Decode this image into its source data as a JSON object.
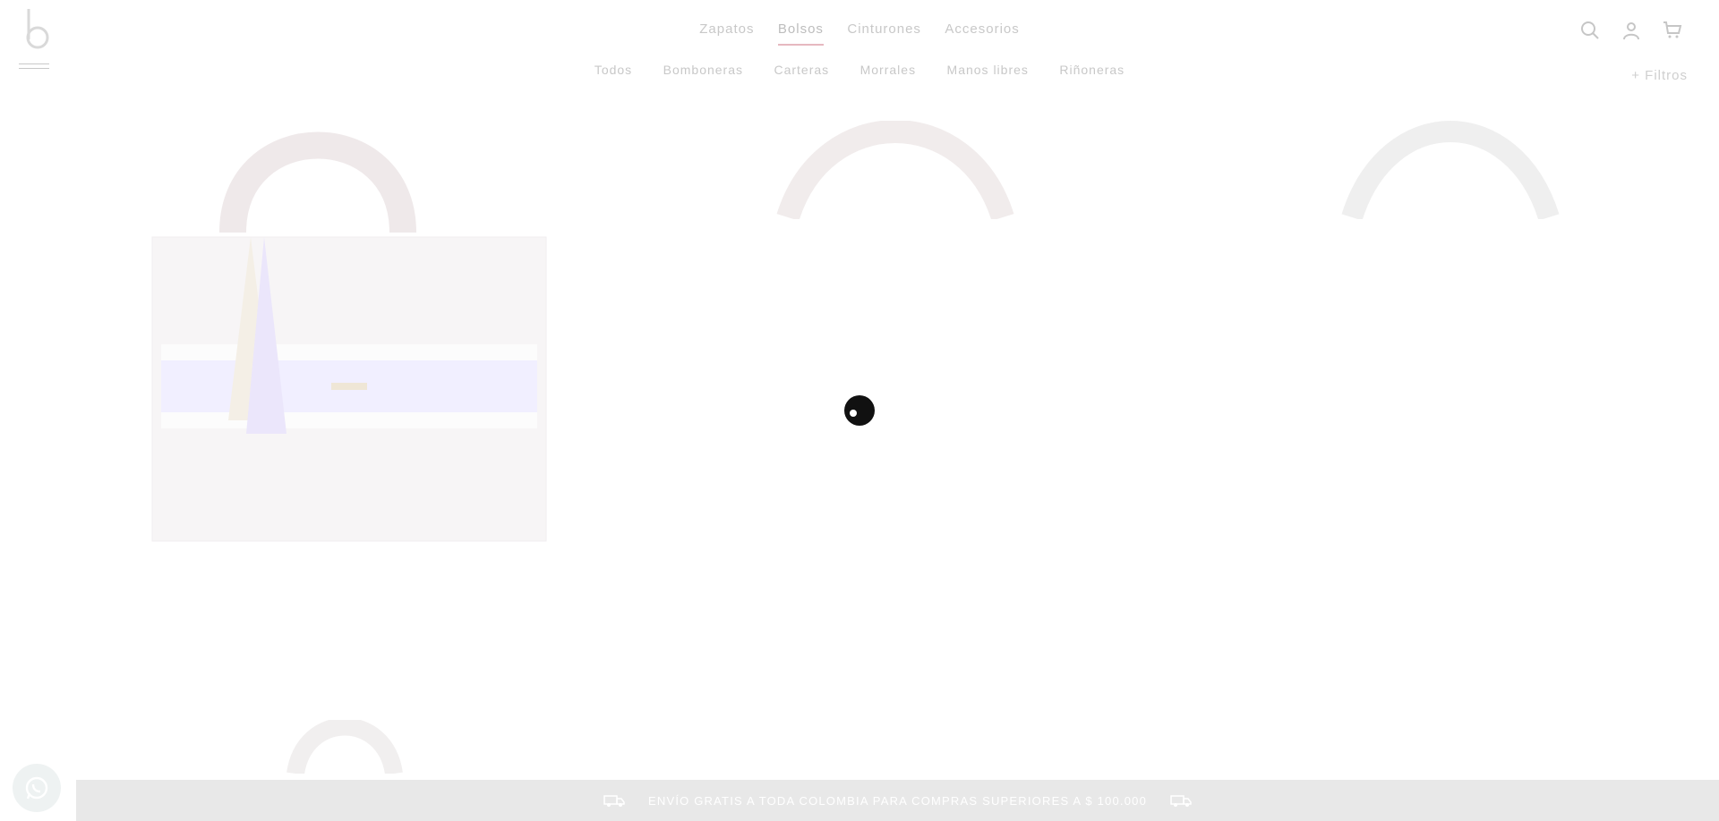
{
  "brand": {
    "logo_icon": "brand-b-logo-icon"
  },
  "main_nav": {
    "items": [
      "Zapatos",
      "Bolsos",
      "Cinturones",
      "Accesorios"
    ],
    "active": "Bolsos"
  },
  "sub_nav": {
    "items": [
      "Todos",
      "Bomboneras",
      "Carteras",
      "Morrales",
      "Manos libres",
      "Riñoneras"
    ]
  },
  "header_icons": [
    "search-icon",
    "user-icon",
    "cart-icon"
  ],
  "filters": {
    "label": "+ Filtros"
  },
  "promo_bar": {
    "text": "ENVÍO GRATIS A TODA COLOMBIA PARA COMPRAS SUPERIORES A $ 100.000"
  },
  "colors": {
    "promo_bar_bg": "#e8e8e8",
    "active_underline": "#e6b8c0",
    "spinner": "#111111",
    "muted_text": "#c8c8c8"
  }
}
